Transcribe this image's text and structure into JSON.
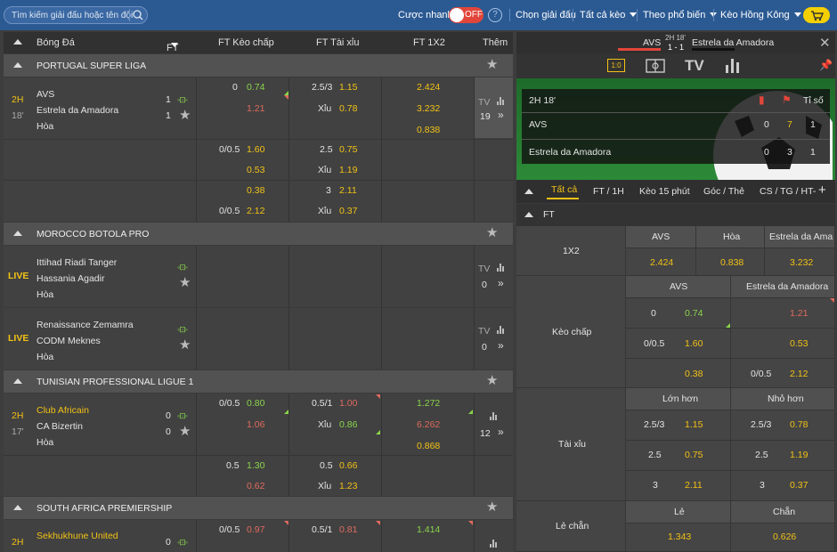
{
  "topbar": {
    "search_placeholder": "Tìm kiếm giải đấu hoặc tên đội",
    "quick_bet": "Cược nhanh",
    "toggle_state": "OFF",
    "help": "?",
    "choose_league": "Chọn giải đấu",
    "all_odds": "Tất cả kèo",
    "sort": "Theo phổ biến",
    "odds_type": "Kèo Hồng Kông"
  },
  "colors": {
    "topbar": "#2b5a93",
    "accent": "#f2c215",
    "up": "#8ad54a",
    "down": "#e06a5e"
  },
  "table_header": {
    "sport": "Bóng Đá",
    "ft": "FT",
    "handicap": "FT Kèo chấp",
    "overunder": "FT Tài xỉu",
    "x12": "FT 1X2",
    "more": "Thêm"
  },
  "leagues": {
    "l1": {
      "name": "PORTUGAL SUPER LIGA"
    },
    "l2": {
      "name": "MOROCCO BOTOLA PRO"
    },
    "l3": {
      "name": "TUNISIAN PROFESSIONAL LIGUE 1"
    },
    "l4": {
      "name": "SOUTH AFRICA PREMIERSHIP"
    }
  },
  "m1": {
    "period": "2H",
    "minute": "18'",
    "home": "AVS",
    "away": "Estrela da Amadora",
    "draw": "Hòa",
    "hs": "1",
    "as": "1",
    "tv": "TV",
    "more_count": "19",
    "lines": [
      {
        "hcp": "0",
        "hcp_h": "0.74",
        "hcp_a": "1.21",
        "ou": "2.5/3",
        "ou_o": "1.15",
        "ou_label": "Xỉu",
        "ou_u": "0.78",
        "x1": "2.424",
        "x2": "3.232",
        "xd": "0.838"
      },
      {
        "hcp": "0/0.5",
        "hcp_h": "1.60",
        "hcp_a": "0.53",
        "ou": "2.5",
        "ou_o": "0.75",
        "ou_label": "Xỉu",
        "ou_u": "1.19"
      },
      {
        "hcp_h": "0.38",
        "hcp": "0/0.5",
        "hcp_a": "2.12",
        "ou": "3",
        "ou_o": "2.11",
        "ou_label": "Xỉu",
        "ou_u": "0.37"
      }
    ]
  },
  "m2": {
    "status": "LIVE",
    "home": "Ittihad Riadi Tanger",
    "away": "Hassania Agadir",
    "draw": "Hòa",
    "tv": "TV",
    "more_count": "0"
  },
  "m3": {
    "status": "LIVE",
    "home": "Renaissance Zemamra",
    "away": "CODM Meknes",
    "draw": "Hòa",
    "tv": "TV",
    "more_count": "0"
  },
  "m4": {
    "period": "2H",
    "minute": "17'",
    "home": "Club Africain",
    "away": "CA Bizertin",
    "draw": "Hòa",
    "hs": "0",
    "as": "0",
    "more_count": "12",
    "lines": [
      {
        "hcp": "0/0.5",
        "hcp_h": "0.80",
        "hcp_a": "1.06",
        "ou": "0.5/1",
        "ou_o": "1.00",
        "ou_label": "Xỉu",
        "ou_u": "0.86",
        "x1": "1.272",
        "x2": "6.262",
        "xd": "0.868"
      },
      {
        "hcp": "0.5",
        "hcp_h": "1.30",
        "hcp_a": "0.62",
        "ou": "0.5",
        "ou_o": "0.66",
        "ou_label": "Xỉu",
        "ou_u": "1.23"
      }
    ]
  },
  "m5": {
    "period": "2H",
    "home": "Sekhukhune United",
    "hs": "0",
    "hcp": "0/0.5",
    "hcp_h": "0.97",
    "ou": "0.5/1",
    "ou_o": "0.81",
    "x1": "1.414"
  },
  "panel": {
    "home": "AVS",
    "away": "Estrela da Amadora",
    "time": "2H 18'",
    "score": "1 - 1",
    "board_time": "2H 18'",
    "score_label": "Tỉ số",
    "home_cols": [
      "0",
      "7",
      "1"
    ],
    "away_cols": [
      "0",
      "3",
      "1"
    ],
    "tabs": [
      "Tất cả",
      "FT / 1H",
      "Kèo 15 phút",
      "Góc / Thẻ",
      "CS / TG / HT-"
    ],
    "section": "FT",
    "x12": {
      "label": "1X2",
      "h1": "AVS",
      "h2": "Hòa",
      "h3": "Estrela da Ama",
      "v1": "2.424",
      "v2": "0.838",
      "v3": "3.232"
    },
    "hcp": {
      "label": "Kèo chấp",
      "h1": "AVS",
      "h2": "Estrela da Amadora",
      "rows": [
        {
          "l": "0",
          "v": "0.74",
          "r": "",
          "rv": "1.21"
        },
        {
          "l": "0/0.5",
          "v": "1.60",
          "r": "",
          "rv": "0.53"
        },
        {
          "l": "",
          "v": "0.38",
          "r": "0/0.5",
          "rv": "2.12"
        }
      ]
    },
    "ou": {
      "label": "Tài xỉu",
      "h1": "Lớn hơn",
      "h2": "Nhỏ hơn",
      "rows": [
        {
          "l": "2.5/3",
          "v": "1.15",
          "r": "2.5/3",
          "rv": "0.78"
        },
        {
          "l": "2.5",
          "v": "0.75",
          "r": "2.5",
          "rv": "1.19"
        },
        {
          "l": "3",
          "v": "2.11",
          "r": "3",
          "rv": "0.37"
        }
      ]
    },
    "oe": {
      "label": "Lẻ chẵn",
      "h1": "Lẻ",
      "h2": "Chẵn",
      "v1": "1.343",
      "v2": "0.626"
    }
  }
}
